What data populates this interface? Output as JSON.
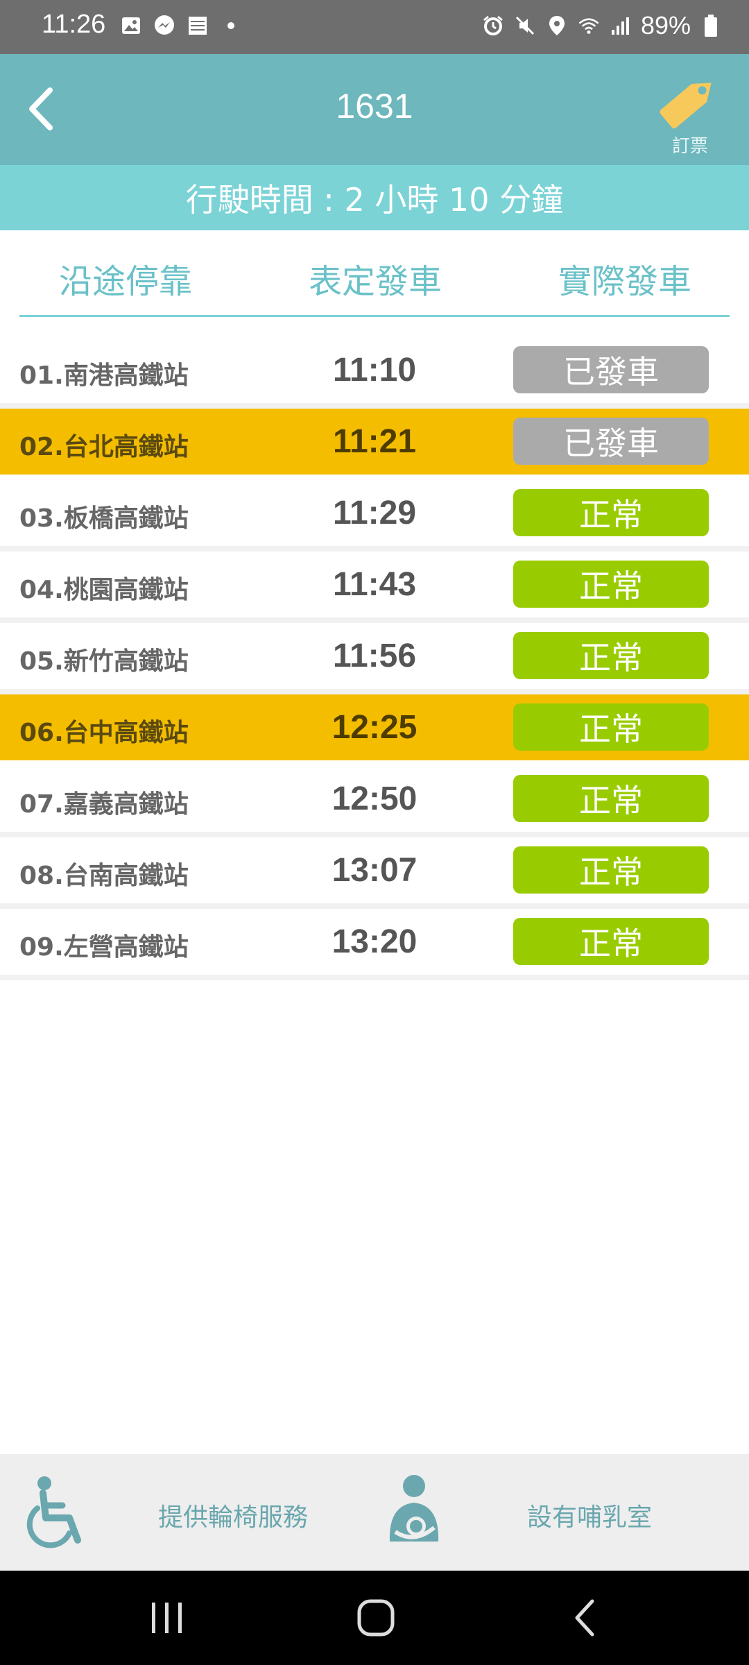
{
  "status_bar": {
    "time": "11:26",
    "battery": "89%",
    "left_icons": [
      "image-icon",
      "messenger-icon",
      "app-icon",
      "dot-icon"
    ],
    "right_icons": [
      "alarm-icon",
      "mute-icon",
      "location-icon",
      "wifi-icon",
      "signal-icon",
      "battery-icon"
    ]
  },
  "header": {
    "title": "1631",
    "booking_label": "訂票",
    "duration": "行駛時間 : 2 小時 10 分鐘"
  },
  "columns": {
    "stop": "沿途停靠",
    "scheduled": "表定發車",
    "actual": "實際發車"
  },
  "stations": [
    {
      "name": "01.南港高鐵站",
      "time": "11:10",
      "status": "已發車",
      "highlight": false,
      "status_color": "#aaaaaa"
    },
    {
      "name": "02.台北高鐵站",
      "time": "11:21",
      "status": "已發車",
      "highlight": true,
      "status_color": "#aaaaaa"
    },
    {
      "name": "03.板橋高鐵站",
      "time": "11:29",
      "status": "正常",
      "highlight": false,
      "status_color": "#99cc00"
    },
    {
      "name": "04.桃園高鐵站",
      "time": "11:43",
      "status": "正常",
      "highlight": false,
      "status_color": "#99cc00"
    },
    {
      "name": "05.新竹高鐵站",
      "time": "11:56",
      "status": "正常",
      "highlight": false,
      "status_color": "#99cc00"
    },
    {
      "name": "06.台中高鐵站",
      "time": "12:25",
      "status": "正常",
      "highlight": true,
      "status_color": "#99cc00"
    },
    {
      "name": "07.嘉義高鐵站",
      "time": "12:50",
      "status": "正常",
      "highlight": false,
      "status_color": "#99cc00"
    },
    {
      "name": "08.台南高鐵站",
      "time": "13:07",
      "status": "正常",
      "highlight": false,
      "status_color": "#99cc00"
    },
    {
      "name": "09.左營高鐵站",
      "time": "13:20",
      "status": "正常",
      "highlight": false,
      "status_color": "#99cc00"
    }
  ],
  "facilities": {
    "wheelchair": "提供輪椅服務",
    "nursing": "設有哺乳室"
  },
  "colors": {
    "header": "#6db7bd",
    "duration_bar": "#7bd3d6",
    "highlight": "#f4bd00",
    "departed": "#aaaaaa",
    "normal": "#99cc00"
  }
}
